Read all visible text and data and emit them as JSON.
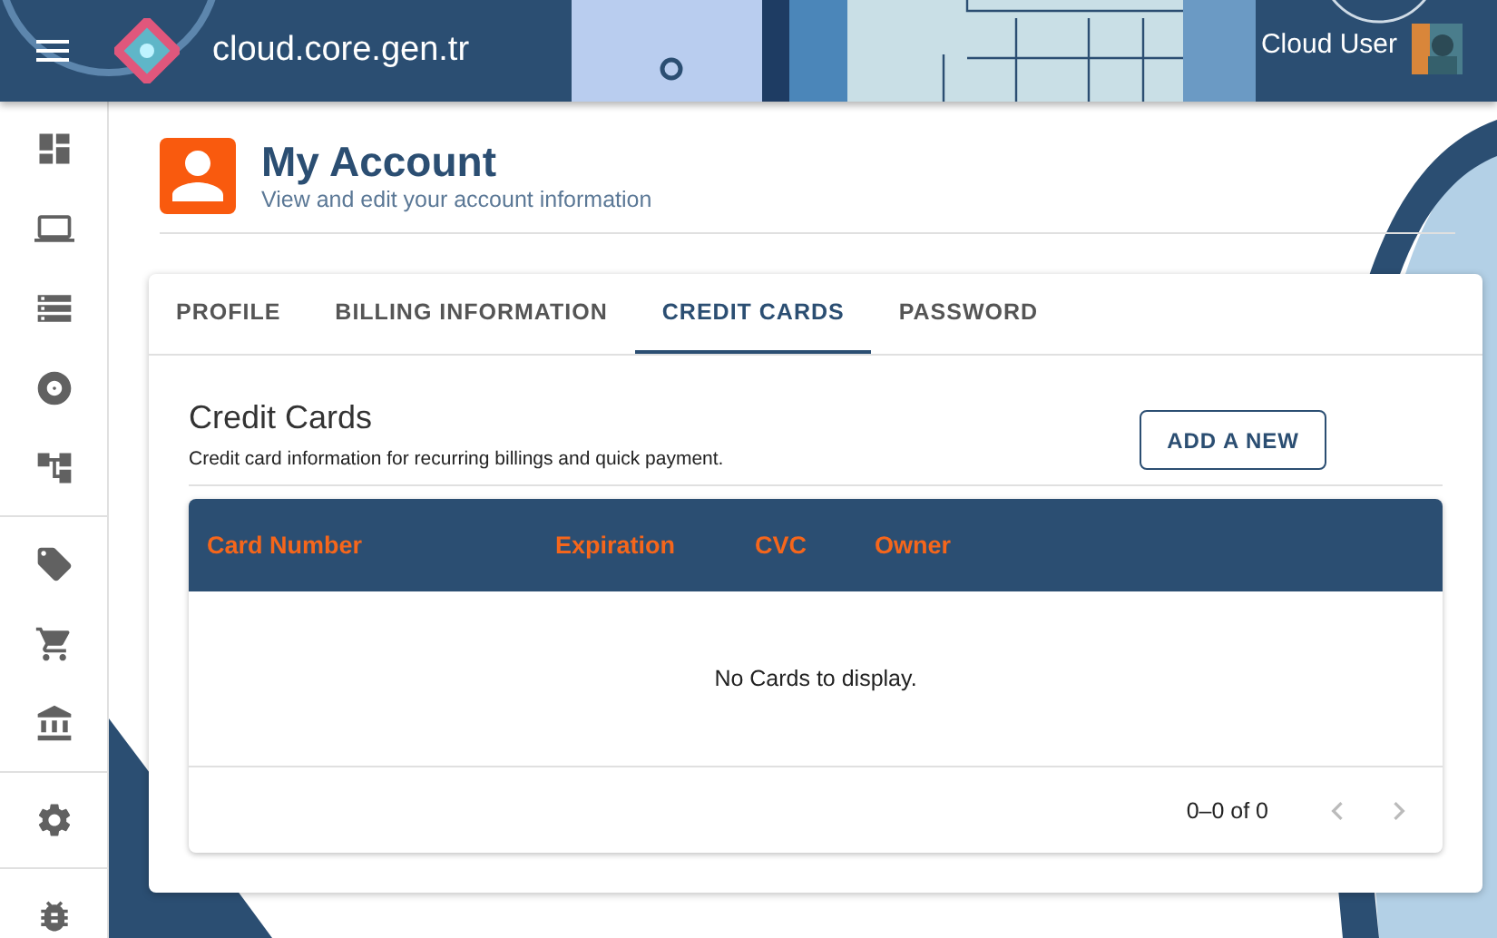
{
  "header": {
    "title": "cloud.core.gen.tr",
    "user": "Cloud User"
  },
  "page": {
    "title": "My Account",
    "subtitle": "View and edit your account information"
  },
  "tabs": [
    {
      "label": "PROFILE",
      "selected": false
    },
    {
      "label": "BILLING INFORMATION",
      "selected": false
    },
    {
      "label": "CREDIT CARDS",
      "selected": true
    },
    {
      "label": "PASSWORD",
      "selected": false
    }
  ],
  "section": {
    "title": "Credit Cards",
    "description": "Credit card information for recurring billings and quick payment.",
    "button": "ADD A NEW"
  },
  "table": {
    "columns": [
      "Card Number",
      "Expiration",
      "CVC",
      "Owner"
    ],
    "empty_message": "No Cards to display.",
    "pagination": {
      "range": "0–0 of 0",
      "previous_disabled": true,
      "next_disabled": true
    }
  }
}
